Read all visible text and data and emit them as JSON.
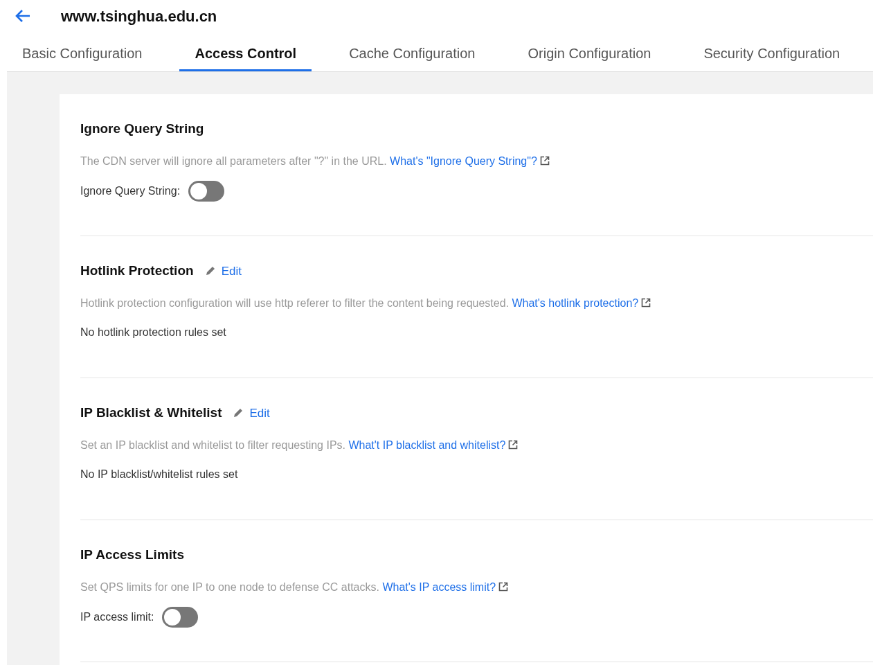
{
  "header": {
    "title": "www.tsinghua.edu.cn"
  },
  "tabs": [
    {
      "label": "Basic Configuration",
      "selected": false
    },
    {
      "label": "Access Control",
      "selected": true
    },
    {
      "label": "Cache Configuration",
      "selected": false
    },
    {
      "label": "Origin Configuration",
      "selected": false
    },
    {
      "label": "Security Configuration",
      "selected": false
    }
  ],
  "sections": [
    {
      "kind": "toggle",
      "title": "Ignore Query String",
      "description": "The CDN server will ignore all parameters after \"?\" in the URL.",
      "link": "What's \"Ignore Query String\"?",
      "toggle_label": "Ignore Query String:",
      "on": false
    },
    {
      "kind": "status",
      "title": "Hotlink Protection",
      "edit": "Edit",
      "description": "Hotlink protection configuration will use http referer to filter the content being requested.",
      "link": "What's hotlink protection?",
      "status": "No hotlink protection rules set"
    },
    {
      "kind": "status",
      "title": "IP Blacklist & Whitelist",
      "edit": "Edit",
      "description": "Set an IP blacklist and whitelist to filter requesting IPs.",
      "link": "What't IP blacklist and whitelist?",
      "status": "No IP blacklist/whitelist rules set"
    },
    {
      "kind": "toggle",
      "title": "IP Access Limits",
      "description": "Set QPS limits for one IP to one node to defense CC attacks.",
      "link": "What's IP access limit?",
      "toggle_label": "IP access limit:",
      "on": false
    }
  ]
}
